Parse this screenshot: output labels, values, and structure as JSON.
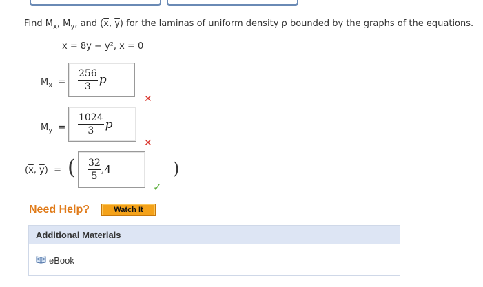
{
  "question": {
    "prefix": "Find M",
    "sub_x": "x",
    "mid1": ", M",
    "sub_y": "y",
    "mid2": ", and (",
    "xbar": "x",
    "comma": ", ",
    "ybar": "y",
    "suffix": ") for the laminas of uniform density ρ bounded by the graphs of the equations."
  },
  "equation": "x = 8y − y², x = 0",
  "answers": {
    "mx": {
      "label_main": "M",
      "label_sub": "x",
      "eq": "=",
      "numerator": "256",
      "denominator": "3",
      "rho": "p",
      "status": "incorrect",
      "mark": "✕"
    },
    "my": {
      "label_main": "M",
      "label_sub": "y",
      "eq": "=",
      "numerator": "1024",
      "denominator": "3",
      "rho": "p",
      "status": "incorrect",
      "mark": "✕"
    },
    "centroid": {
      "label_open": "(",
      "label_x": "x",
      "label_comma": ", ",
      "label_y": "y",
      "label_close": ")",
      "eq": "=",
      "open_paren": "(",
      "numerator": "32",
      "denominator": "5",
      "separator": ",",
      "second": "4",
      "close_paren": ")",
      "status": "correct",
      "mark": "✓"
    }
  },
  "help": {
    "need_help": "Need Help?",
    "watch_it": "Watch It"
  },
  "materials": {
    "title": "Additional Materials",
    "ebook": "eBook"
  },
  "colors": {
    "incorrect": "#d9342b",
    "correct": "#5aae3a",
    "orange_text": "#e07b1a",
    "button": "#f4a21a",
    "panel_header": "#dde5f4"
  },
  "icons": {
    "incorrect": "cross-icon",
    "correct": "check-icon",
    "ebook": "book-icon"
  }
}
